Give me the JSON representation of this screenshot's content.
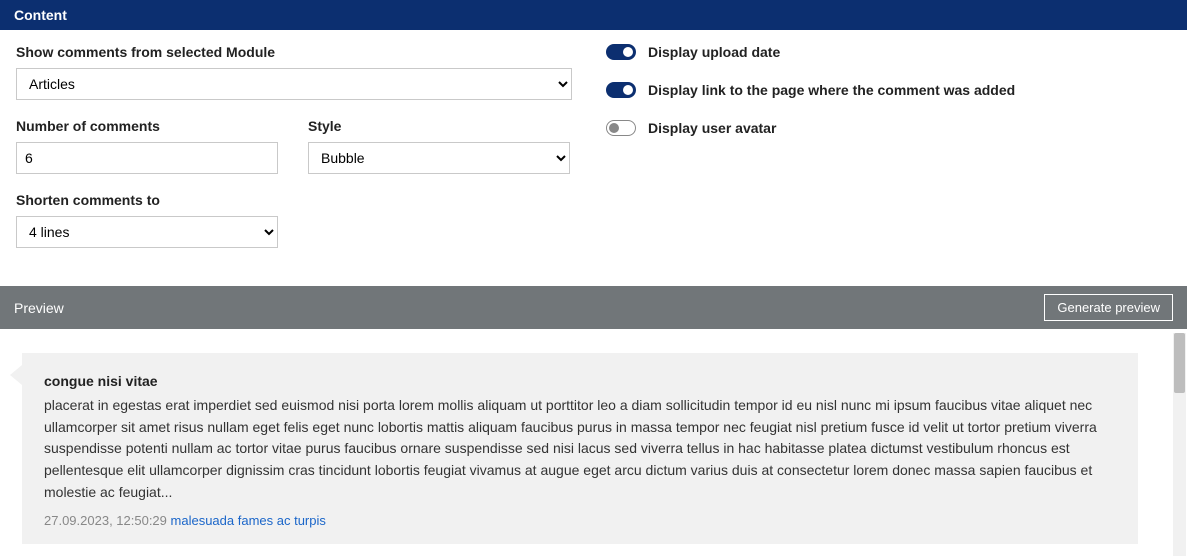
{
  "header": {
    "title": "Content"
  },
  "left": {
    "moduleLabel": "Show comments from selected Module",
    "moduleValue": "Articles",
    "numberLabel": "Number of comments",
    "numberValue": "6",
    "styleLabel": "Style",
    "styleValue": "Bubble",
    "shortenLabel": "Shorten comments to",
    "shortenValue": "4 lines"
  },
  "right": {
    "uploadDate": "Display upload date",
    "linkPage": "Display link to the page where the comment was added",
    "userAvatar": "Display user avatar"
  },
  "preview": {
    "title": "Preview",
    "generate": "Generate preview",
    "commentTitle": "congue nisi vitae",
    "commentText": "placerat in egestas erat imperdiet sed euismod nisi porta lorem mollis aliquam ut porttitor leo a diam sollicitudin tempor id eu nisl nunc mi ipsum faucibus vitae aliquet nec ullamcorper sit amet risus nullam eget felis eget nunc lobortis mattis aliquam faucibus purus in massa tempor nec feugiat nisl pretium fusce id velit ut tortor pretium viverra suspendisse potenti nullam ac tortor vitae purus faucibus ornare suspendisse sed nisi lacus sed viverra tellus in hac habitasse platea dictumst vestibulum rhoncus est pellentesque elit ullamcorper dignissim cras tincidunt lobortis feugiat vivamus at augue eget arcu dictum varius duis at consectetur lorem donec massa sapien faucibus et molestie ac feugiat...",
    "date": "27.09.2023, 12:50:29",
    "link": "malesuada fames ac turpis"
  }
}
